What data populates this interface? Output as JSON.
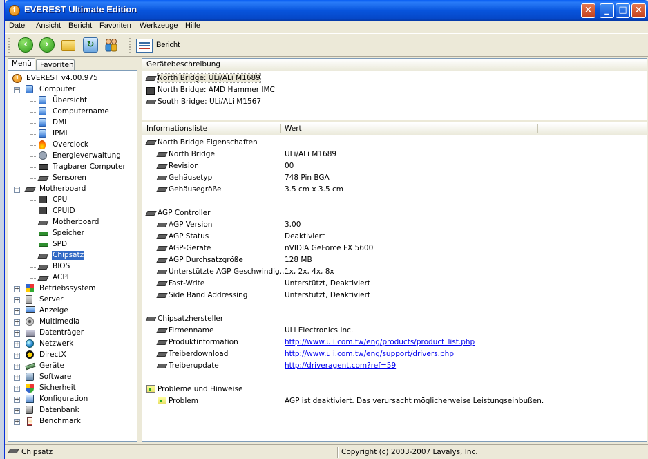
{
  "window": {
    "title": "EVEREST Ultimate Edition",
    "controls": {
      "close": "×",
      "minimize": "_",
      "maximize": "□",
      "close2": "×"
    }
  },
  "menu": [
    "Datei",
    "Ansicht",
    "Bericht",
    "Favoriten",
    "Werkzeuge",
    "Hilfe"
  ],
  "toolbar": {
    "report_label": "Bericht"
  },
  "tabs": {
    "menu": "Menü",
    "favorites": "Favoriten"
  },
  "tree": {
    "root": "EVEREST v4.00.975",
    "computer": {
      "label": "Computer",
      "children": [
        "Übersicht",
        "Computername",
        "DMI",
        "IPMI",
        "Overclock",
        "Energieverwaltung",
        "Tragbarer Computer",
        "Sensoren"
      ]
    },
    "motherboard": {
      "label": "Motherboard",
      "children": [
        "CPU",
        "CPUID",
        "Motherboard",
        "Speicher",
        "SPD",
        "Chipsatz",
        "BIOS",
        "ACPI"
      ]
    },
    "others": [
      "Betriebssystem",
      "Server",
      "Anzeige",
      "Multimedia",
      "Datenträger",
      "Netzwerk",
      "DirectX",
      "Geräte",
      "Software",
      "Sicherheit",
      "Konfiguration",
      "Datenbank",
      "Benchmark"
    ],
    "selected": "Chipsatz"
  },
  "device_list": {
    "header": "Gerätebeschreibung",
    "items": [
      "North Bridge: ULi/ALi M1689",
      "North Bridge: AMD Hammer IMC",
      "South Bridge: ULi/ALi M1567"
    ]
  },
  "info": {
    "col_field": "Informationsliste",
    "col_value": "Wert",
    "sections": [
      {
        "title": "North Bridge Eigenschaften",
        "rows": [
          {
            "field": "North Bridge",
            "value": "ULi/ALi M1689"
          },
          {
            "field": "Revision",
            "value": "00"
          },
          {
            "field": "Gehäusetyp",
            "value": "748 Pin BGA"
          },
          {
            "field": "Gehäusegröße",
            "value": "3.5 cm x 3.5 cm"
          }
        ]
      },
      {
        "title": "AGP Controller",
        "rows": [
          {
            "field": "AGP Version",
            "value": "3.00"
          },
          {
            "field": "AGP Status",
            "value": "Deaktiviert"
          },
          {
            "field": "AGP-Geräte",
            "value": "nVIDIA GeForce FX 5600"
          },
          {
            "field": "AGP Durchsatzgröße",
            "value": "128 MB"
          },
          {
            "field": "Unterstützte AGP Geschwindig...",
            "value": "1x, 2x, 4x, 8x"
          },
          {
            "field": "Fast-Write",
            "value": "Unterstützt, Deaktiviert"
          },
          {
            "field": "Side Band Addressing",
            "value": "Unterstützt, Deaktiviert"
          }
        ]
      },
      {
        "title": "Chipsatzhersteller",
        "rows": [
          {
            "field": "Firmenname",
            "value": "ULi Electronics Inc."
          },
          {
            "field": "Produktinformation",
            "value": "http://www.uli.com.tw/eng/products/product_list.php"
          },
          {
            "field": "Treiberdownload",
            "value": "http://www.uli.com.tw/eng/support/drivers.php"
          },
          {
            "field": "Treiberupdate",
            "value": "http://driveragent.com?ref=59"
          }
        ]
      },
      {
        "title": "Probleme und Hinweise",
        "rows": [
          {
            "field": "Problem",
            "value": "AGP ist deaktiviert. Das verursacht möglicherweise Leistungseinbußen."
          }
        ]
      }
    ]
  },
  "status": {
    "left": "Chipsatz",
    "right": "Copyright (c) 2003-2007 Lavalys, Inc."
  }
}
